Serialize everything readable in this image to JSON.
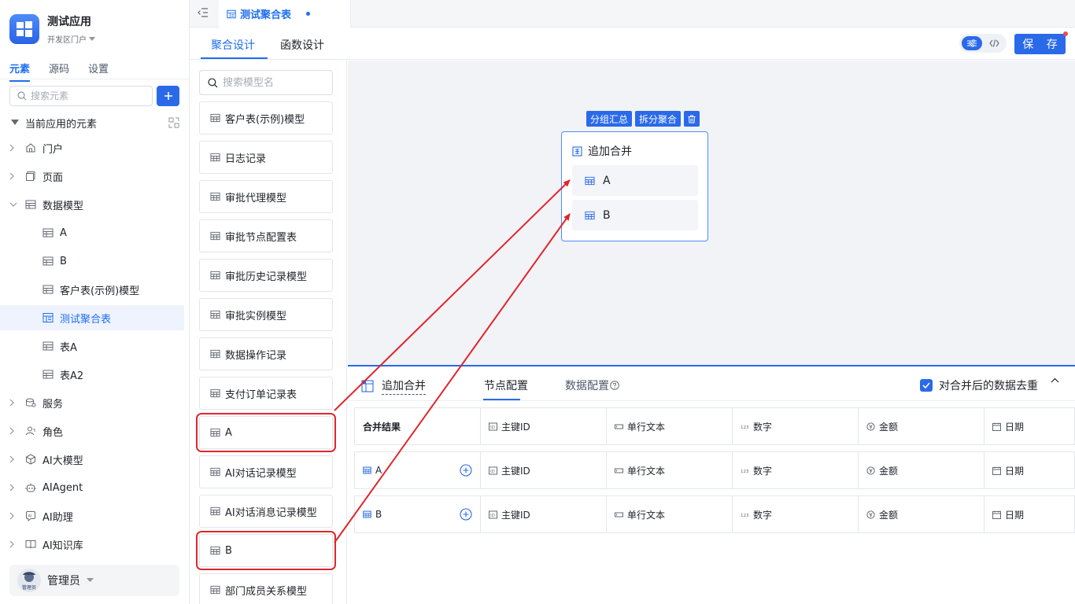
{
  "app": {
    "title": "测试应用",
    "subtitle": "开发区门户"
  },
  "sidebar": {
    "tabs": [
      {
        "label": "元素",
        "active": true
      },
      {
        "label": "源码",
        "active": false
      },
      {
        "label": "设置",
        "active": false
      }
    ],
    "search_placeholder": "搜索元素",
    "section_label": "当前应用的元素",
    "items": [
      {
        "label": "门户",
        "icon": "home-icon"
      },
      {
        "label": "页面",
        "icon": "page-icon"
      },
      {
        "label": "数据模型",
        "icon": "table-icon"
      },
      {
        "label": "A",
        "icon": "table-icon"
      },
      {
        "label": "B",
        "icon": "table-icon"
      },
      {
        "label": "客户表(示例)模型",
        "icon": "table-icon"
      },
      {
        "label": "测试聚合表",
        "icon": "aggregate-table-icon",
        "active": true
      },
      {
        "label": "表A",
        "icon": "table-icon"
      },
      {
        "label": "表A2",
        "icon": "table-icon"
      },
      {
        "label": "服务",
        "icon": "service-icon"
      },
      {
        "label": "角色",
        "icon": "role-icon"
      },
      {
        "label": "AI大模型",
        "icon": "model-cube-icon"
      },
      {
        "label": "AIAgent",
        "icon": "robot-icon"
      },
      {
        "label": "AI助理",
        "icon": "ai-assistant-icon"
      },
      {
        "label": "AI知识库",
        "icon": "book-icon"
      }
    ],
    "user": {
      "name": "管理员",
      "avatar_text": "管理员"
    }
  },
  "topbar": {
    "tab_label": "测试聚合表"
  },
  "designbar": {
    "tabs": [
      "聚合设计",
      "函数设计"
    ],
    "save_label": "保 存"
  },
  "models": {
    "search_placeholder": "搜索模型名",
    "items": [
      "客户表(示例)模型",
      "日志记录",
      "审批代理模型",
      "审批节点配置表",
      "审批历史记录模型",
      "审批实例模型",
      "数据操作记录",
      "支付订单记录表",
      "A",
      "AI对话记录模型",
      "AI对话消息记录模型",
      "B",
      "部门成员关系模型"
    ]
  },
  "canvas": {
    "toolbar": [
      "分组汇总",
      "拆分聚合"
    ],
    "node": {
      "title": "追加合并",
      "items": [
        "A",
        "B"
      ]
    }
  },
  "config": {
    "title": "追加合并",
    "tabs": [
      "节点配置",
      "数据配置"
    ],
    "dedupe_label": "对合并后的数据去重",
    "rows": [
      {
        "label": "合并结果",
        "cells": [
          "主键ID",
          "单行文本",
          "数字",
          "金额",
          "日期"
        ]
      },
      {
        "label": "A",
        "cells": [
          "主键ID",
          "单行文本",
          "数字",
          "金额",
          "日期"
        ]
      },
      {
        "label": "B",
        "cells": [
          "主键ID",
          "单行文本",
          "数字",
          "金额",
          "日期"
        ]
      }
    ]
  },
  "colors": {
    "accent": "#2a6ae9",
    "highlight_red": "#e0262c"
  }
}
